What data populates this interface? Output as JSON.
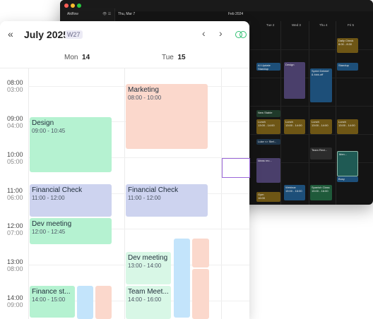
{
  "dark_window": {
    "app_name": "Akiflow",
    "month_label": "Feb 2024",
    "date_header": "Thu, Mar 7",
    "days": [
      "Tue 2",
      "Wed 3",
      "Thu 4",
      "Fri 5"
    ],
    "events": [
      {
        "title": "Daily Check",
        "time": "8:00 - 8:30"
      },
      {
        "title": "AI Update",
        "time": "Standup"
      },
      {
        "title": "Design",
        "time": ""
      },
      {
        "title": "Sprint Debrief & kick-off",
        "time": ""
      },
      {
        "title": "Standup",
        "time": ""
      },
      {
        "title": "New Stable",
        "time": ""
      },
      {
        "title": "Lunch",
        "time": "13:00 - 14:00"
      },
      {
        "title": "Lunch",
        "time": "13:00 - 14:00"
      },
      {
        "title": "Lunch",
        "time": "13:00 - 14:00"
      },
      {
        "title": "Lunch",
        "time": "13:00 - 14:00"
      },
      {
        "title": "Luke <> Stef...",
        "time": ""
      },
      {
        "title": "Team Revi...",
        "time": ""
      },
      {
        "title": "Ideas rec...",
        "time": ""
      },
      {
        "title": "Men...",
        "time": ""
      },
      {
        "title": "Busy",
        "time": ""
      },
      {
        "title": "Webinar",
        "time": "15:00 - 16:00"
      },
      {
        "title": "Spanish Class",
        "time": "15:00 - 16:00"
      },
      {
        "title": "Gym",
        "time": "16:00"
      }
    ],
    "colors": {
      "green": "#1f5a3a",
      "blue": "#1d4f79",
      "purple": "#4a3f6b",
      "gold": "#6e5615",
      "gray": "#2c2c2c"
    }
  },
  "toolbar": {
    "title": "July 2025",
    "week": "W27",
    "collapse_icon": "double-chevron-left",
    "prev_icon": "chevron-left",
    "next_icon": "chevron-right",
    "toggle_icon": "overlap-circles"
  },
  "days": [
    {
      "name": "Mon",
      "num": "14"
    },
    {
      "name": "Tue",
      "num": "15"
    }
  ],
  "time_rows": [
    {
      "primary": "08:00",
      "secondary": "03:00"
    },
    {
      "primary": "09:00",
      "secondary": "04:00"
    },
    {
      "primary": "10:00",
      "secondary": "05:00"
    },
    {
      "primary": "11:00",
      "secondary": "06:00"
    },
    {
      "primary": "12:00",
      "secondary": "07:00"
    },
    {
      "primary": "13:00",
      "secondary": "08:00"
    },
    {
      "primary": "14:00",
      "secondary": "09:00"
    }
  ],
  "events": {
    "marketing": {
      "title": "Marketing",
      "time": "08:00 - 10:00"
    },
    "design": {
      "title": "Design",
      "time": "09:00 - 10:45"
    },
    "financial_mon": {
      "title": "Financial Check",
      "time": "11:00 - 12:00"
    },
    "financial_tue": {
      "title": "Financial Check",
      "time": "11:00 - 12:00"
    },
    "dev_meeting_mon": {
      "title": "Dev meeting",
      "time": "12:00 - 12:45"
    },
    "dev_meeting_tue": {
      "title": "Dev meeting",
      "time": "13:00 - 14:00"
    },
    "finance_st": {
      "title": "Finance st...",
      "time": "14:00 - 15:00"
    },
    "team_meet": {
      "title": "Team Meet...",
      "time": "14:00 - 16:00"
    }
  },
  "colors": {
    "event_green": "#b5f2d1",
    "event_green_light": "#d8f7e6",
    "event_lavender": "#cdd3ef",
    "event_salmon": "#fbd8cc",
    "event_blue": "#c3e4fb",
    "accent_purple": "#9a66d8"
  }
}
